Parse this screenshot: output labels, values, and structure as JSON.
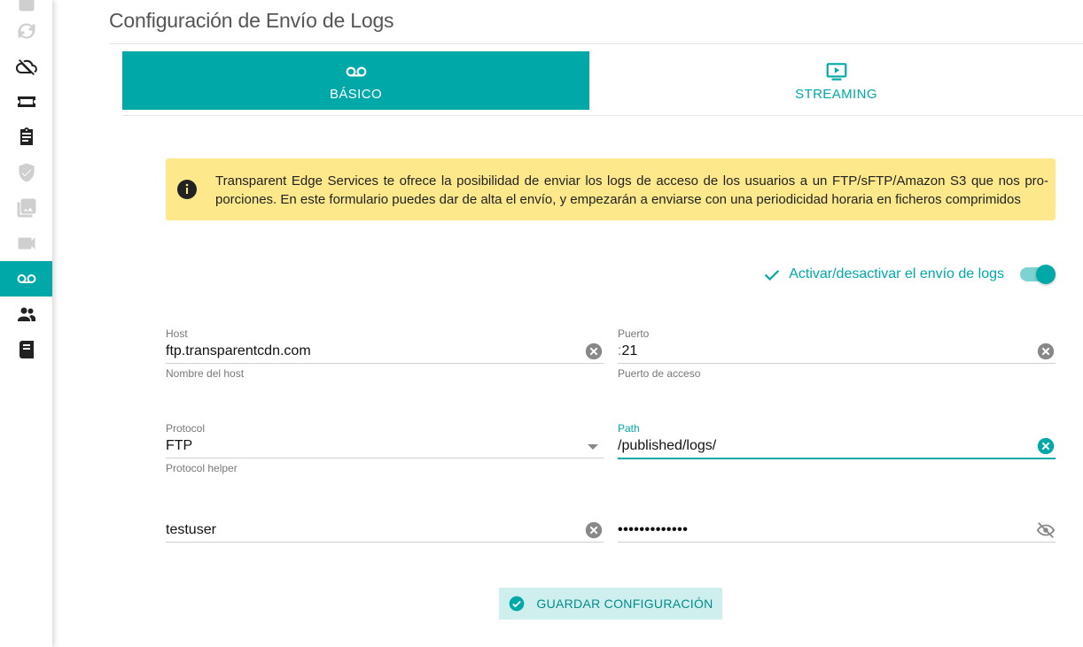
{
  "page": {
    "title": "Configuración de Envío de Logs"
  },
  "sidebar": {
    "items": [
      {
        "icon": "list-icon"
      },
      {
        "icon": "refresh-icon"
      },
      {
        "icon": "cloud-off-icon"
      },
      {
        "icon": "ticket-icon"
      },
      {
        "icon": "clipboard-icon"
      },
      {
        "icon": "shield-check-icon"
      },
      {
        "icon": "photo-library-icon"
      },
      {
        "icon": "video-camera-icon"
      },
      {
        "icon": "voicemail-icon",
        "active": true
      },
      {
        "icon": "people-icon"
      },
      {
        "icon": "book-icon"
      }
    ]
  },
  "tabs": [
    {
      "label": "BÁSICO",
      "icon": "voicemail-icon",
      "active": true
    },
    {
      "label": "STREAMING",
      "icon": "tv-play-icon",
      "active": false
    }
  ],
  "banner": {
    "icon": "info-icon",
    "text": "Transparent Edge Services te ofrece la posibilidad de enviar los logs de acceso de los usuarios a un FTP/sFTP/Amazon S3 que nos pro-porciones. En este formulario puedes dar de alta el envío, y empezarán a enviarse con una periodicidad horaria en ficheros comprimidos"
  },
  "toggle": {
    "label": "Activar/desactivar el envío de logs",
    "enabled": true
  },
  "form": {
    "host": {
      "label": "Host",
      "value": "ftp.transparentcdn.com",
      "hint": "Nombre del host"
    },
    "port": {
      "label": "Puerto",
      "prefix": ":",
      "value": "21",
      "hint": "Puerto de acceso"
    },
    "protocol": {
      "label": "Protocol",
      "value": "FTP",
      "hint": "Protocol helper"
    },
    "path": {
      "label": "Path",
      "value": "/published/logs/"
    },
    "user": {
      "value": "testuser"
    },
    "password": {
      "value": "•••••••••••••"
    }
  },
  "save_button": {
    "label": "GUARDAR CONFIGURACIÓN"
  },
  "colors": {
    "accent": "#00a8a8",
    "banner_bg": "#fde98c",
    "save_bg": "#cfeeee"
  }
}
